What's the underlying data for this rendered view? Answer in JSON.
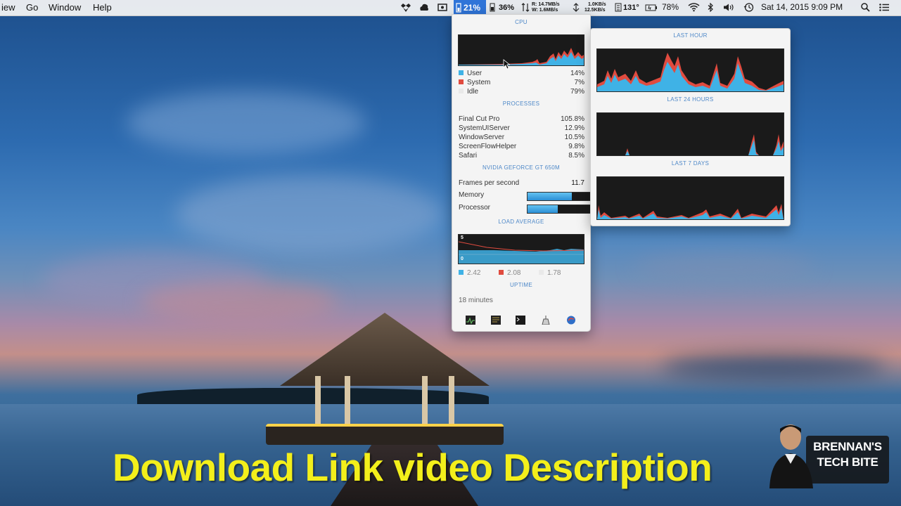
{
  "menubar": {
    "left_items": [
      "iew",
      "Go",
      "Window",
      "Help"
    ],
    "cpu_active": "21%",
    "mem": "36%",
    "net_read": "R: 14.7MB/s",
    "net_write": "W:  1.6MB/s",
    "disk_read": "1.0KB/s",
    "disk_write": "12.5KB/s",
    "temp": "131°",
    "battery": "78%",
    "datetime": "Sat 14, 2015  9:09 PM",
    "icons": [
      "dropbox-icon",
      "cloud-app-icon",
      "screen-icon",
      "memory-icon",
      "network-icon",
      "disk-icon",
      "temperature-icon",
      "battery-icon",
      "wifi-icon",
      "bluetooth-icon",
      "volume-icon",
      "time-machine-icon",
      "search-icon",
      "list-icon"
    ]
  },
  "panel": {
    "cpu_title": "CPU",
    "cpu_legend": [
      {
        "label": "User",
        "value": "14%",
        "color": "#3fb2e6"
      },
      {
        "label": "System",
        "value": "7%",
        "color": "#e04b3f"
      },
      {
        "label": "Idle",
        "value": "79%",
        "color": "#e9e9e9"
      }
    ],
    "processes_title": "PROCESSES",
    "processes": [
      {
        "name": "Final Cut Pro",
        "value": "105.8%"
      },
      {
        "name": "SystemUIServer",
        "value": "12.9%"
      },
      {
        "name": "WindowServer",
        "value": "10.5%"
      },
      {
        "name": "ScreenFlowHelper",
        "value": "9.8%"
      },
      {
        "name": "Safari",
        "value": "8.5%"
      }
    ],
    "gpu_title": "NVIDIA GEFORCE GT 650M",
    "fps_label": "Frames per second",
    "fps_value": "11.7",
    "memory_label": "Memory",
    "memory_level": 0.7,
    "processor_label": "Processor",
    "processor_level": 0.48,
    "load_title": "LOAD AVERAGE",
    "load_axis_top": "5",
    "load_axis_bottom": "0",
    "load_values": [
      {
        "value": "2.42",
        "color": "#3fb2e6"
      },
      {
        "value": "2.08",
        "color": "#e04b3f"
      },
      {
        "value": "1.78",
        "color": "#e9e9e9"
      }
    ],
    "uptime_title": "UPTIME",
    "uptime_value": "18 minutes",
    "footer_icons": [
      "activity-monitor-icon",
      "console-icon",
      "terminal-icon",
      "cleanup-icon",
      "stats-icon"
    ]
  },
  "history": {
    "last_hour": "LAST HOUR",
    "last_24": "LAST 24 HOURS",
    "last_7": "LAST 7 DAYS"
  },
  "overlay": {
    "caption": "Download Link video Description",
    "logo_line1": "BRENNAN'S",
    "logo_line2": "TECH BITE"
  }
}
